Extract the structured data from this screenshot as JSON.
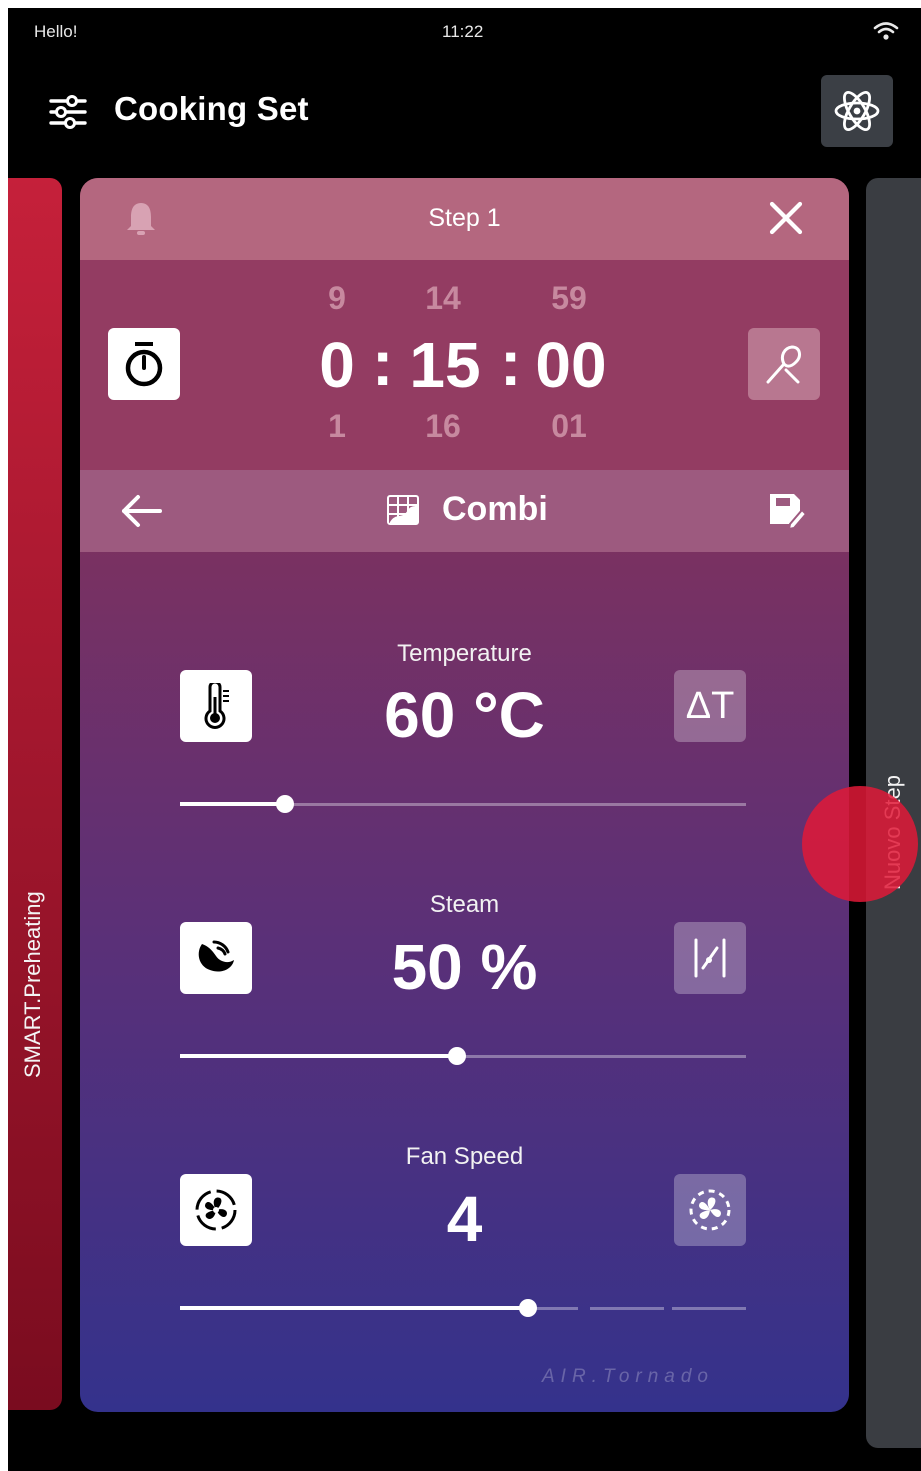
{
  "status_bar": {
    "greeting": "Hello!",
    "time": "11:22"
  },
  "header": {
    "title": "Cooking Set"
  },
  "side_panels": {
    "left_label": "SMART.Preheating",
    "right_label": "Nuovo Step"
  },
  "step": {
    "title": "Step 1"
  },
  "timer": {
    "hours": "0",
    "minutes": "15",
    "seconds": "00",
    "hours_prev": "9",
    "minutes_prev": "14",
    "seconds_prev": "59",
    "hours_next": "1",
    "minutes_next": "16",
    "seconds_next": "01",
    "separator": ":"
  },
  "mode": {
    "name": "Combi"
  },
  "temperature": {
    "label": "Temperature",
    "value": "60 °C",
    "delta_label": "ΔT",
    "slider_fraction": 0.185
  },
  "steam": {
    "label": "Steam",
    "value": "50 %",
    "slider_fraction": 0.49
  },
  "fan": {
    "label": "Fan Speed",
    "value": "4",
    "slider_fraction": 0.615,
    "brand": "AIR.Tornado"
  },
  "colors": {
    "accent": "#c5203a",
    "card_top": "#b4677f",
    "card_bottom": "#34328c"
  }
}
